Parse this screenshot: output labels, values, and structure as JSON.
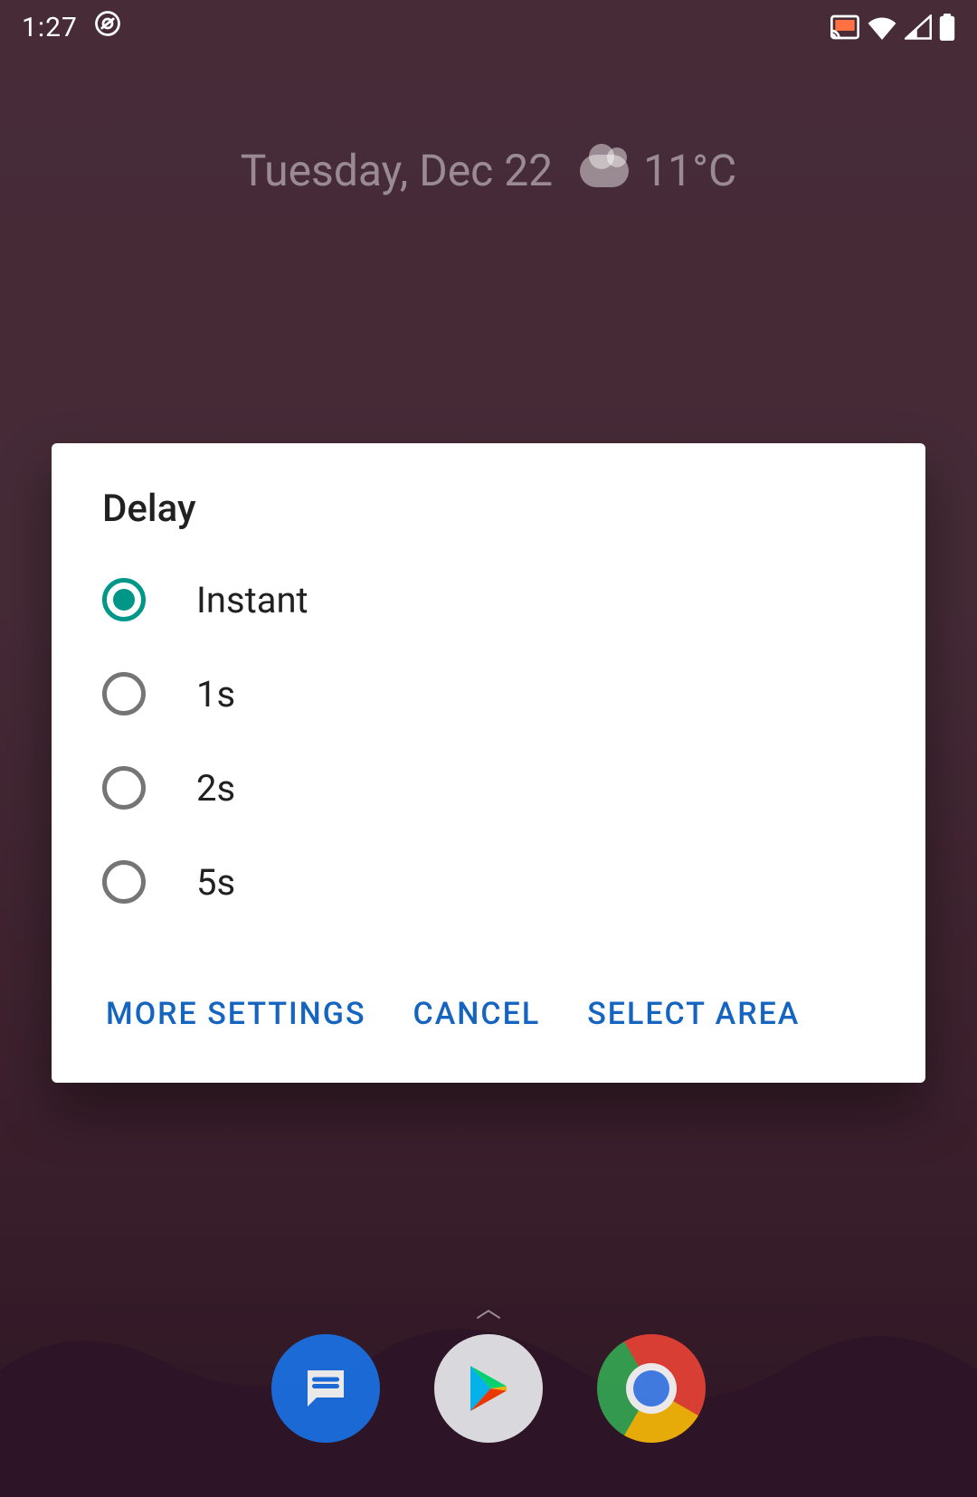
{
  "status": {
    "time": "1:27",
    "cast_active": true,
    "wifi": true,
    "signal": true,
    "battery": true
  },
  "widget": {
    "date": "Tuesday, Dec 22",
    "temp": "11°C"
  },
  "dialog": {
    "title": "Delay",
    "options": [
      {
        "label": "Instant",
        "selected": true
      },
      {
        "label": "1s",
        "selected": false
      },
      {
        "label": "2s",
        "selected": false
      },
      {
        "label": "5s",
        "selected": false
      }
    ],
    "actions": {
      "more": "MORE SETTINGS",
      "cancel": "CANCEL",
      "select_area": "SELECT AREA"
    }
  },
  "dock": {
    "apps": [
      "messages",
      "play-store",
      "chrome"
    ]
  },
  "colors": {
    "accent": "#009688",
    "action": "#1565c0"
  }
}
